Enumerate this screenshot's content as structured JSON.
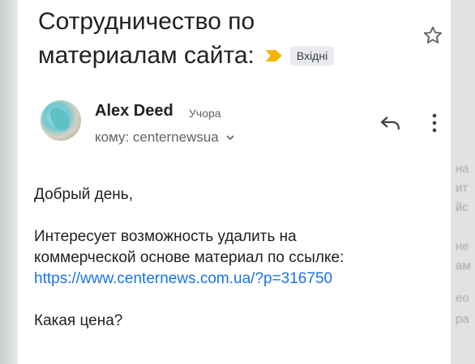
{
  "email": {
    "subject_line1": "Сотрудничество по",
    "subject_line2": "материалам сайта:",
    "label_chip": "Вхідні",
    "sender_name": "Alex Deed",
    "time": "Учора",
    "recipient": "кому: centernewsua",
    "body": {
      "greeting": "Добрый день,",
      "line1": "Интересует возможность удалить на",
      "line2": "коммерческой основе материал по ссылке:",
      "link": "https://www.centernews.com.ua/?p=316750",
      "closing": "Какая цена?"
    }
  },
  "icons": {
    "star": "star-outline-icon",
    "label": "important-label-icon",
    "reply": "reply-icon",
    "more": "more-vertical-icon",
    "chevron": "chevron-down-icon"
  },
  "colors": {
    "label_arrow": "#f4b400",
    "link": "#1a73e8",
    "text": "#202124",
    "secondary_text": "#5f6368"
  }
}
